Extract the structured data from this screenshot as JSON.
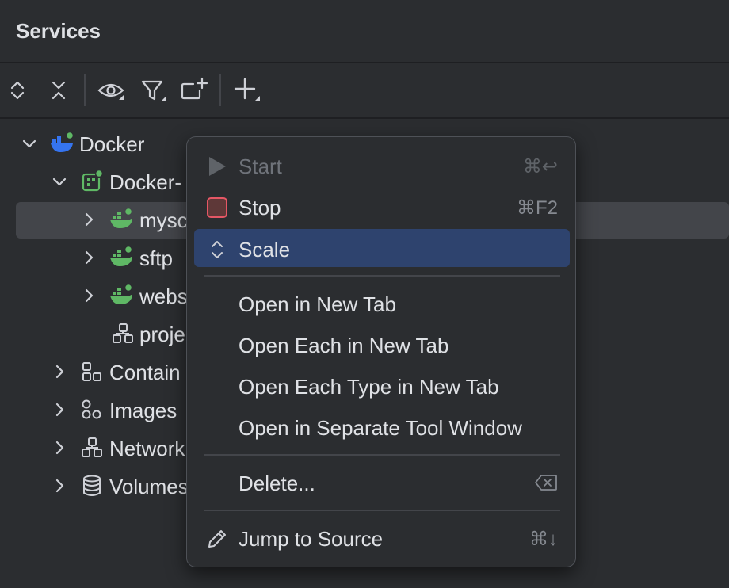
{
  "panel": {
    "title": "Services"
  },
  "toolbar": {
    "buttons": [
      {
        "icon": "expand-all-icon"
      },
      {
        "icon": "collapse-all-icon"
      },
      {
        "icon": "eye-icon"
      },
      {
        "icon": "filter-icon"
      },
      {
        "icon": "new-group-icon"
      },
      {
        "icon": "add-icon"
      }
    ]
  },
  "tree": {
    "items": [
      {
        "label": "Docker",
        "icon": "docker-icon"
      },
      {
        "label": "Docker-",
        "icon": "compose-icon"
      },
      {
        "label": "mysc",
        "icon": "docker-service-icon"
      },
      {
        "label": "sftp",
        "icon": "docker-service-icon"
      },
      {
        "label": "webs",
        "icon": "docker-service-icon"
      },
      {
        "label": "proje",
        "icon": "network-icon"
      },
      {
        "label": "Contain",
        "icon": "containers-icon"
      },
      {
        "label": "Images",
        "icon": "images-icon"
      },
      {
        "label": "Network",
        "icon": "network-icon"
      },
      {
        "label": "Volumes",
        "icon": "volumes-icon"
      }
    ]
  },
  "context_menu": {
    "start": {
      "label": "Start",
      "shortcut": "⌘↩",
      "icon": "play-icon",
      "enabled": false
    },
    "stop": {
      "label": "Stop",
      "shortcut": "⌘F2",
      "icon": "stop-icon"
    },
    "scale": {
      "label": "Scale",
      "icon": "scale-icon"
    },
    "open_new_tab": {
      "label": "Open in New Tab"
    },
    "open_each_new_tab": {
      "label": "Open Each in New Tab"
    },
    "open_each_type": {
      "label": "Open Each Type in New Tab"
    },
    "open_separate": {
      "label": "Open in Separate Tool Window"
    },
    "delete": {
      "label": "Delete...",
      "icon": "delete-key-icon"
    },
    "jump": {
      "label": "Jump to Source",
      "shortcut": "⌘↓",
      "icon": "pencil-icon"
    }
  },
  "colors": {
    "background": "#2b2d30",
    "selection": "#43454a",
    "menu_highlight": "#2e436e",
    "docker_blue": "#3574f0",
    "service_green": "#5fb865",
    "stop_red": "#e55765"
  }
}
